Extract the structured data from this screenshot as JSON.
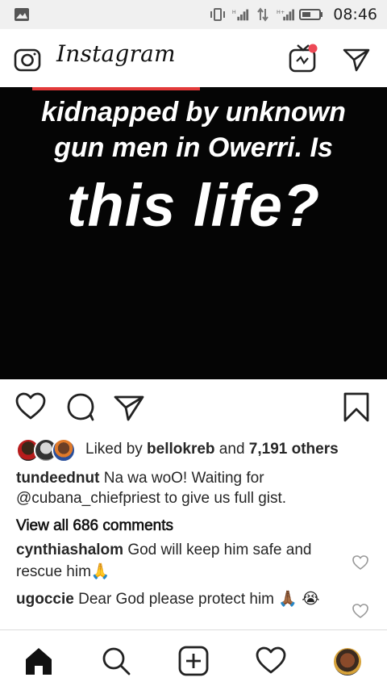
{
  "status_bar": {
    "time": "08:46",
    "icons": [
      "image-icon",
      "vibrate-icon",
      "signal-h-icon",
      "data-arrows-icon",
      "signal-h-plus-icon",
      "battery-icon"
    ]
  },
  "app_bar": {
    "logo_text": "Instagram",
    "icons": [
      "camera-icon",
      "igtv-icon",
      "direct-message-icon"
    ]
  },
  "post": {
    "image_text_line1": "kidnapped by unknown",
    "image_text_line2": "gun men in Owerri. Is",
    "image_text_line3": "this life?",
    "actions": [
      "heart-icon",
      "comment-icon",
      "share-icon",
      "bookmark-icon"
    ],
    "likes": {
      "prefix": "Liked by ",
      "user": "bellokreb",
      "middle": " and ",
      "count": "7,191 others"
    },
    "caption": {
      "user": "tundeednut",
      "text": " Na wa woO! Waiting for @cubana_chiefpriest to give us full gist."
    },
    "view_all": "View all 686 comments",
    "comments": [
      {
        "user": "cynthiashalom",
        "text": " God will keep him safe and rescue him🙏"
      },
      {
        "user": "ugoccie",
        "text": " Dear God please protect him 🙏🏾 😭"
      }
    ]
  },
  "bottom_nav": [
    "home-icon",
    "search-icon",
    "add-post-icon",
    "activity-heart-icon",
    "profile-avatar"
  ],
  "colors": {
    "accent_red": "#ed4956",
    "text": "#262626"
  }
}
